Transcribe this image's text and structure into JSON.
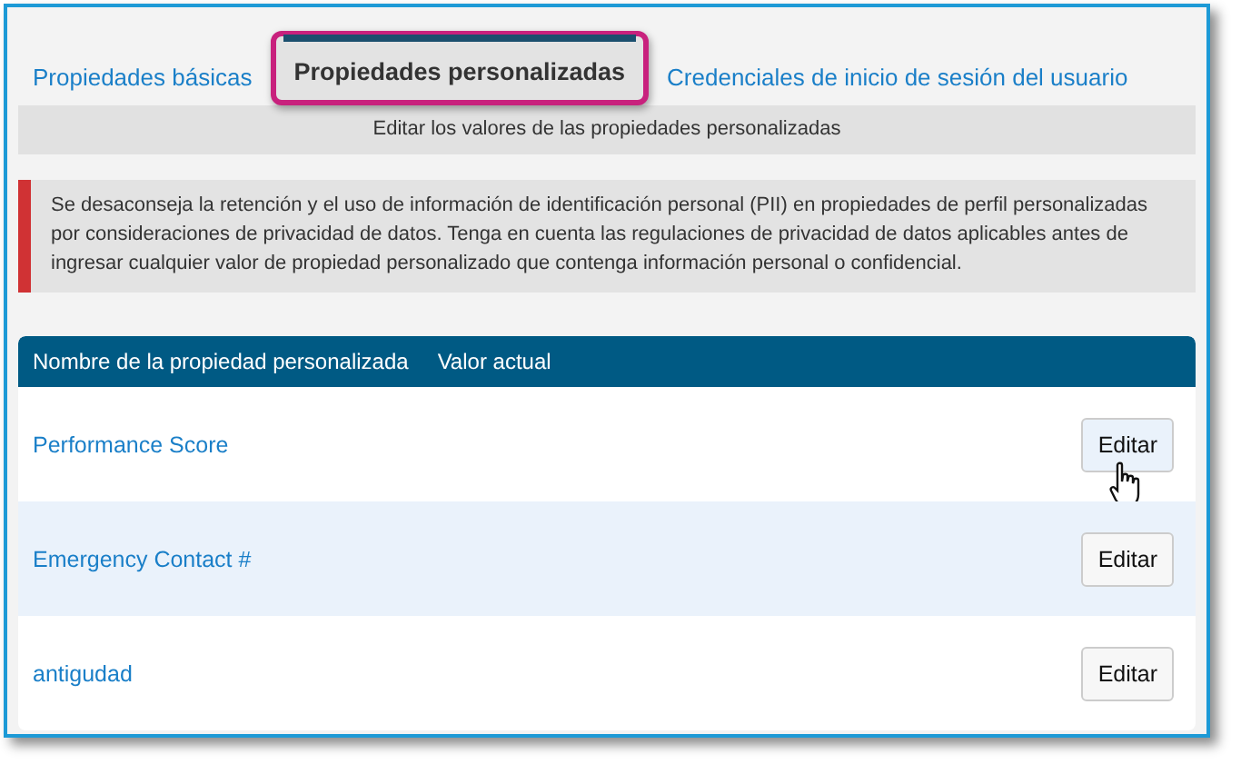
{
  "tabs": [
    {
      "label": "Propiedades básicas",
      "selected": false
    },
    {
      "label": "Propiedades personalizadas",
      "selected": true
    },
    {
      "label": "Credenciales de inicio de sesión del usuario",
      "selected": false
    }
  ],
  "section_header": "Editar los valores de las propiedades personalizadas",
  "warning": "Se desaconseja la retención y el uso de información de identificación personal (PII) en propiedades de perfil personalizadas por consideraciones de privacidad de datos. Tenga en cuenta las regulaciones de privacidad de datos aplicables antes de ingresar cualquier valor de propiedad personalizado que contenga información personal o confidencial.",
  "table": {
    "columns": [
      "Nombre de la propiedad personalizada",
      "Valor actual"
    ],
    "rows": [
      {
        "name": "Performance Score",
        "button": "Editar",
        "hovered": true
      },
      {
        "name": "Emergency Contact #",
        "button": "Editar",
        "hovered": false
      },
      {
        "name": "antigudad",
        "button": "Editar",
        "hovered": false
      }
    ]
  }
}
